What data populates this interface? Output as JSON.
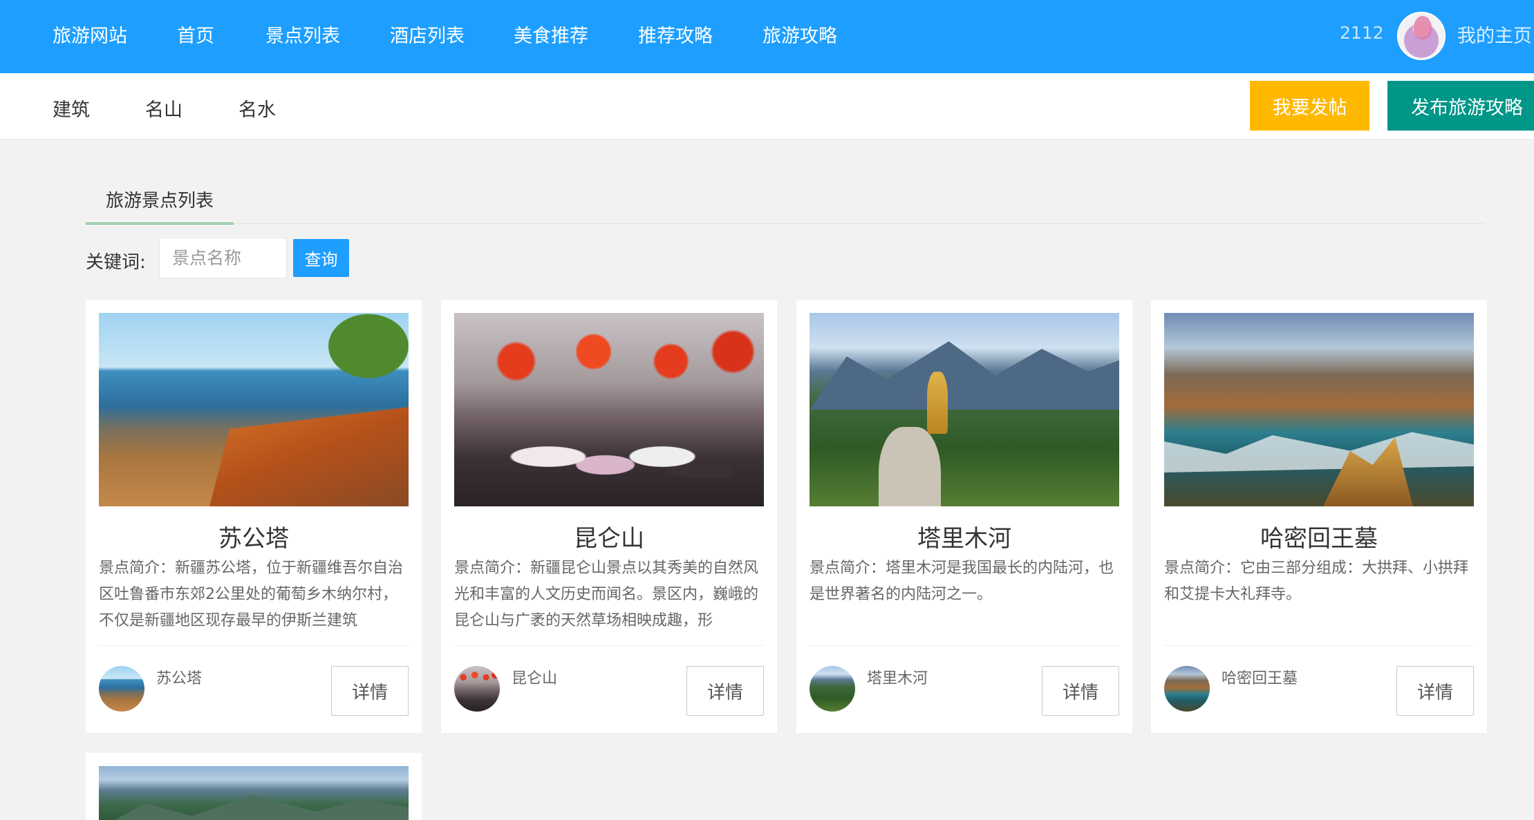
{
  "header": {
    "brand": "旅游网站",
    "nav": [
      "首页",
      "景点列表",
      "酒店列表",
      "美食推荐",
      "推荐攻略",
      "旅游攻略"
    ],
    "user_id": "2112",
    "my_home": "我的主页"
  },
  "subnav": {
    "categories": [
      "建筑",
      "名山",
      "名水"
    ],
    "post_button": "我要发帖",
    "publish_button": "发布旅游攻略"
  },
  "tab": {
    "title": "旅游景点列表"
  },
  "search": {
    "label": "关键词:",
    "placeholder": "景点名称",
    "button": "查询"
  },
  "cards": [
    {
      "name": "苏公塔",
      "desc": "景点简介：新疆苏公塔，位于新疆维吾尔自治区吐鲁番市东郊2公里处的葡萄乡木纳尔村，不仅是新疆地区现存最早的伊斯兰建筑",
      "mini_name": "苏公塔",
      "detail": "详情"
    },
    {
      "name": "昆仑山",
      "desc": "景点简介：新疆昆仑山景点以其秀美的自然风光和丰富的人文历史而闻名。景区内，巍峨的昆仑山与广袤的天然草场相映成趣，形",
      "mini_name": "昆仑山",
      "detail": "详情"
    },
    {
      "name": "塔里木河",
      "desc": "景点简介：塔里木河是我国最长的内陆河，也是世界著名的内陆河之一。",
      "mini_name": "塔里木河",
      "detail": "详情"
    },
    {
      "name": "哈密回王墓",
      "desc": "景点简介：它由三部分组成：大拱拜、小拱拜和艾提卡大礼拜寺。",
      "mini_name": "哈密回王墓",
      "detail": "详情"
    }
  ]
}
